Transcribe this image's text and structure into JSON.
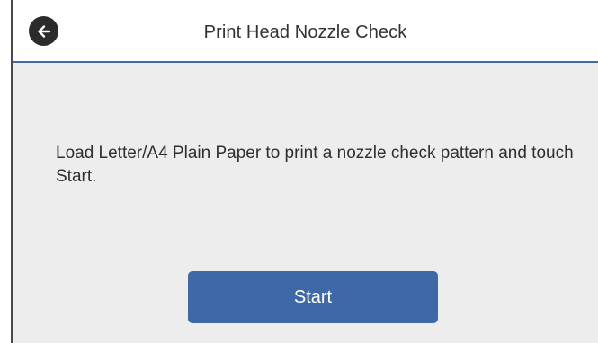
{
  "header": {
    "title": "Print Head Nozzle Check",
    "back_icon": "arrow-left-icon"
  },
  "main": {
    "message": "Load Letter/A4 Plain Paper to print a nozzle check pattern and touch Start."
  },
  "actions": {
    "start_label": "Start"
  },
  "colors": {
    "accent": "#3e68a6",
    "background": "#ededed",
    "header_background": "#ffffff",
    "back_button": "#2b2b2b"
  }
}
